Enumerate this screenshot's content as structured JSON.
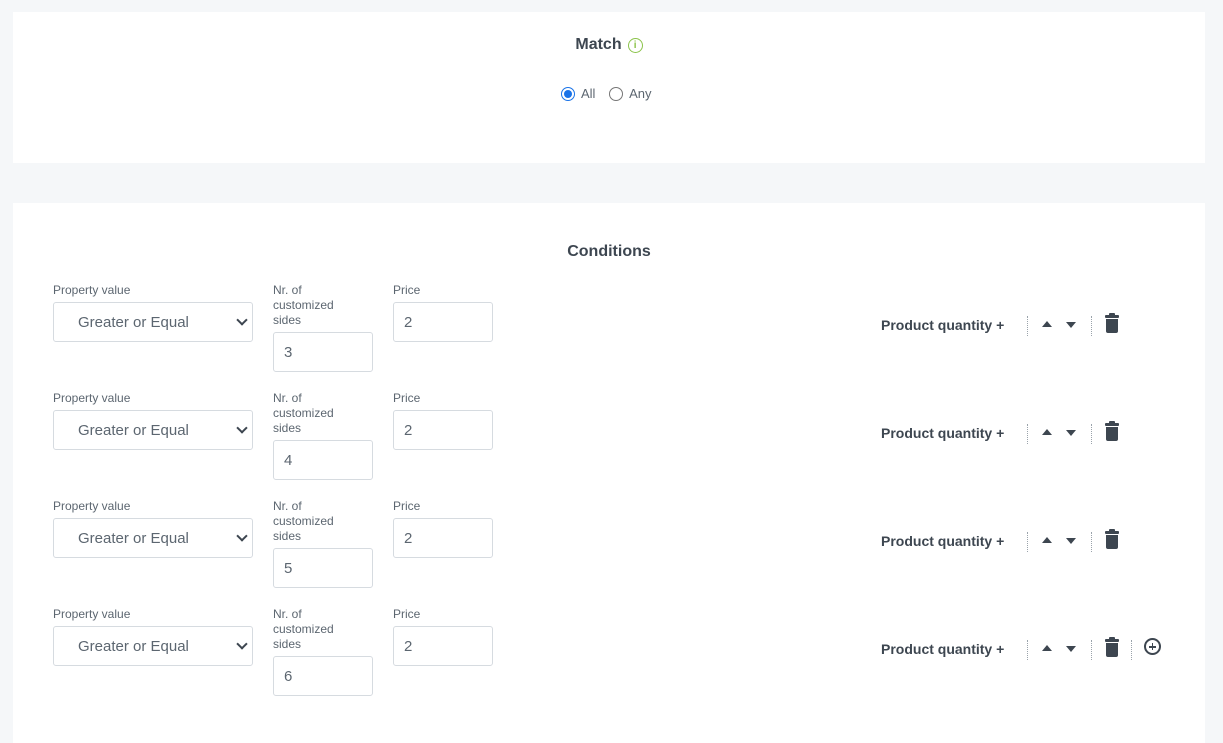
{
  "match": {
    "title": "Match",
    "icon": "info-icon",
    "options": [
      {
        "label": "All",
        "checked": true
      },
      {
        "label": "Any",
        "checked": false
      }
    ]
  },
  "conditions": {
    "title": "Conditions",
    "rows": [
      {
        "property_label": "Property value",
        "operator": "Greater or Equal",
        "sides_label_1": "Nr. of",
        "sides_label_2": "customized",
        "sides_label_3": "sides",
        "sides_value": "3",
        "price_label": "Price",
        "price_value": "2",
        "quantity_label": "Product quantity +"
      },
      {
        "property_label": "Property value",
        "operator": "Greater or Equal",
        "sides_label_1": "Nr. of",
        "sides_label_2": "customized",
        "sides_label_3": "sides",
        "sides_value": "4",
        "price_label": "Price",
        "price_value": "2",
        "quantity_label": "Product quantity +"
      },
      {
        "property_label": "Property value",
        "operator": "Greater or Equal",
        "sides_label_1": "Nr. of",
        "sides_label_2": "customized",
        "sides_label_3": "sides",
        "sides_value": "5",
        "price_label": "Price",
        "price_value": "2",
        "quantity_label": "Product quantity +"
      },
      {
        "property_label": "Property value",
        "operator": "Greater or Equal",
        "sides_label_1": "Nr. of",
        "sides_label_2": "customized",
        "sides_label_3": "sides",
        "sides_value": "6",
        "price_label": "Price",
        "price_value": "2",
        "quantity_label": "Product quantity +"
      }
    ]
  },
  "colors": {
    "accent": "#1a73e8",
    "info": "#8bc34a",
    "text_dark": "#3d4650"
  }
}
